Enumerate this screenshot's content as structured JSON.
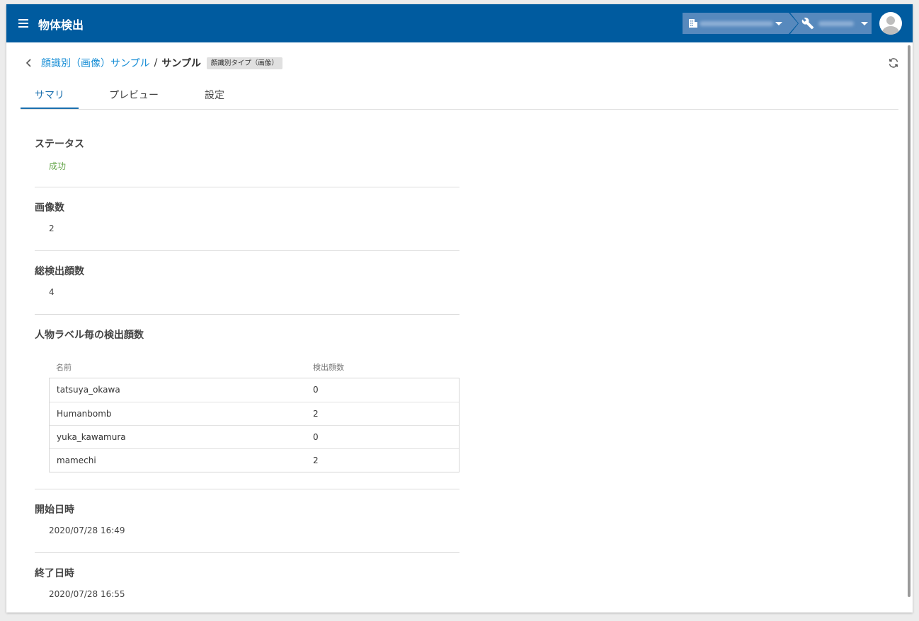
{
  "app": {
    "title": "物体検出"
  },
  "breadcrumb": {
    "parent": "顔識別（画像）サンプル",
    "separator": "/",
    "current": "サンプル",
    "type_badge": "顔識別タイプ（画像）"
  },
  "tabs": [
    {
      "label": "サマリ",
      "active": true
    },
    {
      "label": "プレビュー",
      "active": false
    },
    {
      "label": "設定",
      "active": false
    }
  ],
  "summary": {
    "status": {
      "label": "ステータス",
      "value": "成功"
    },
    "image_count": {
      "label": "画像数",
      "value": "2"
    },
    "total_faces": {
      "label": "総検出顔数",
      "value": "4"
    },
    "per_label": {
      "label": "人物ラベル毎の検出顔数",
      "columns": [
        "名前",
        "検出顔数"
      ],
      "rows": [
        {
          "name": "tatsuya_okawa",
          "count": "0"
        },
        {
          "name": "Humanbomb",
          "count": "2"
        },
        {
          "name": "yuka_kawamura",
          "count": "0"
        },
        {
          "name": "mamechi",
          "count": "2"
        }
      ]
    },
    "start_time": {
      "label": "開始日時",
      "value": "2020/07/28 16:49"
    },
    "end_time": {
      "label": "終了日時",
      "value": "2020/07/28 16:55"
    }
  },
  "colors": {
    "appbar": "#005b9f",
    "link": "#1a8fd6",
    "tab_active": "#1a6fae",
    "status_success": "#6aa84f"
  },
  "icons": {
    "menu": "menu-icon",
    "building": "building-icon",
    "wrench": "wrench-icon",
    "avatar": "avatar",
    "back": "chevron-left-icon",
    "refresh": "refresh-icon"
  }
}
